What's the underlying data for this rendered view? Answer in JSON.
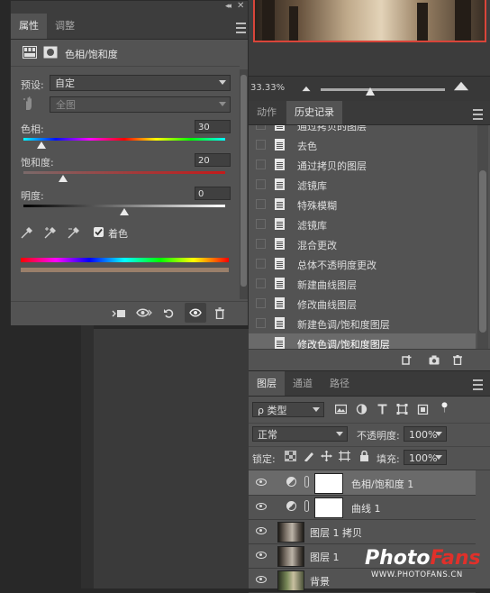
{
  "properties_panel": {
    "tabs": [
      {
        "label": "属性",
        "active": true
      },
      {
        "label": "调整",
        "active": false
      }
    ],
    "header_title": "色相/饱和度",
    "preset_label": "预设:",
    "preset_value": "自定",
    "channel_value": "全图",
    "sliders": [
      {
        "label": "色相:",
        "value": "30",
        "level": 0.083
      },
      {
        "label": "饱和度:",
        "value": "20",
        "level": 0.2
      },
      {
        "label": "明度:",
        "value": "0",
        "level": 0.5
      }
    ],
    "colorize_label": "着色",
    "colorize_checked": true,
    "icons": [
      "eyedropper-icon",
      "eyedropper-plus-icon",
      "eyedropper-minus-icon",
      "clip-to-layer-icon",
      "view-previous-icon",
      "reset-icon",
      "visibility-icon",
      "trash-icon"
    ]
  },
  "navigator": {
    "zoom": "33.33%"
  },
  "history_panel": {
    "tabs": [
      {
        "label": "动作",
        "active": false
      },
      {
        "label": "历史记录",
        "active": true
      }
    ],
    "items": [
      {
        "label": "通过拷贝的图层",
        "selected": false
      },
      {
        "label": "去色",
        "selected": false
      },
      {
        "label": "通过拷贝的图层",
        "selected": false
      },
      {
        "label": "滤镜库",
        "selected": false
      },
      {
        "label": "特殊模糊",
        "selected": false
      },
      {
        "label": "滤镜库",
        "selected": false
      },
      {
        "label": "混合更改",
        "selected": false
      },
      {
        "label": "总体不透明度更改",
        "selected": false
      },
      {
        "label": "新建曲线图层",
        "selected": false
      },
      {
        "label": "修改曲线图层",
        "selected": false
      },
      {
        "label": "新建色调/饱和度图层",
        "selected": false
      },
      {
        "label": "修改色调/饱和度图层",
        "selected": true
      }
    ]
  },
  "layers_panel": {
    "tabs": [
      {
        "label": "图层",
        "active": true
      },
      {
        "label": "通道",
        "active": false
      },
      {
        "label": "路径",
        "active": false
      }
    ],
    "filter_kind": "ρ 类型",
    "blend_mode": "正常",
    "opacity_label": "不透明度:",
    "opacity_value": "100%",
    "lock_label": "锁定:",
    "fill_label": "填充:",
    "fill_value": "100%",
    "layers": [
      {
        "name": "色相/饱和度 1",
        "type": "adjustment",
        "selected": true
      },
      {
        "name": "曲线 1",
        "type": "adjustment",
        "selected": false
      },
      {
        "name": "图层 1 拷贝",
        "type": "pixel",
        "selected": false
      },
      {
        "name": "图层 1",
        "type": "pixel",
        "selected": false
      },
      {
        "name": "背景",
        "type": "pixel",
        "selected": false
      }
    ]
  },
  "watermark": {
    "logo_photo": "Photo",
    "logo_fans": "Fans",
    "url": "WWW.PHOTOFANS.CN"
  },
  "colors": {
    "panel_bg": "#535353",
    "selected_row": "#6a6a6a",
    "nav_frame": "#d9453a",
    "watermark_red": "#e0302a"
  }
}
